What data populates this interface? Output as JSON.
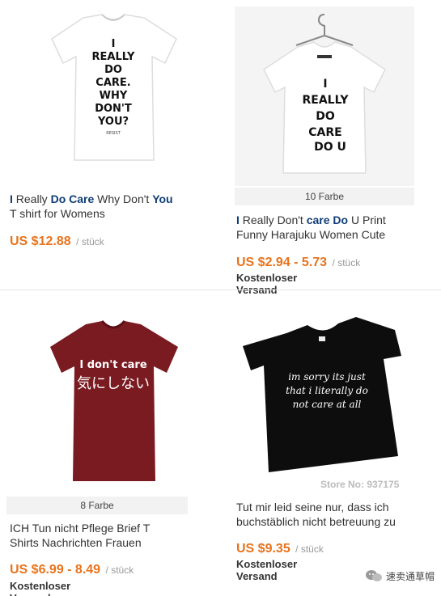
{
  "products": [
    {
      "title_parts": [
        "I",
        " Really ",
        "Do Care",
        " Why Don't ",
        "You"
      ],
      "title_line2": "T shirt for Womens",
      "shirt_text": [
        "I",
        "REALLY",
        "DO",
        "CARE.",
        "WHY",
        "DON'T",
        "YOU?"
      ],
      "shirt_subtext": "RESIST",
      "price": "US $12.88",
      "unit": "/ stück",
      "shirt_color": "#ffffff"
    },
    {
      "color_count": "10 Farbe",
      "title_parts": [
        "I",
        " Really Don't ",
        "care",
        " ",
        "Do",
        " U Print"
      ],
      "title_line2": "Funny Harajuku Women Cute",
      "shirt_text": [
        "I",
        "REALLY",
        "DO",
        "CARE",
        "DO U"
      ],
      "price": "US $2.94 - 5.73",
      "unit": "/ stück",
      "shipping": "Kostenloser Versand",
      "shirt_color": "#ffffff"
    },
    {
      "color_count": "8 Farbe",
      "title_line1": "ICH Tun nicht Pflege Brief T",
      "title_line2": "Shirts Nachrichten Frauen",
      "shirt_text": [
        "I don't care",
        "気にしない"
      ],
      "price": "US $6.99 - 8.49",
      "unit": "/ stück",
      "shipping": "Kostenloser Versand",
      "shirt_color": "#7a1b22"
    },
    {
      "title_line1": "Tut mir leid seine nur, dass ich",
      "title_line2": "buchstäblich nicht betreuung zu",
      "shirt_text": [
        "im sorry its just",
        "that i literally do",
        "not care at all"
      ],
      "store_no": "Store No: 937175",
      "price": "US $9.35",
      "unit": "/ stück",
      "shipping": "Kostenloser Versand",
      "shirt_color": "#0d0d0d"
    }
  ],
  "watermark": "速卖通草帽"
}
